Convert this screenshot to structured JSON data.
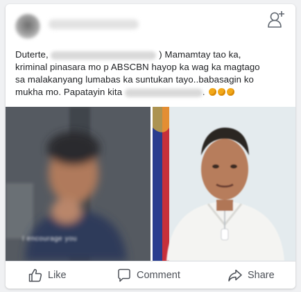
{
  "post": {
    "text_lines": [
      {
        "before": "Duterte,",
        "after": ") Mamamtay tao ka,"
      },
      {
        "text": "kriminal pinasara mo p ABSCBN hayop ka wag ka magtago"
      },
      {
        "text": "sa malakanyang lumabas ka suntukan tayo..babasagin ko"
      },
      {
        "before": "mukha mo. Papatayin kita",
        "after": "."
      }
    ]
  },
  "images": {
    "left_caption_blurred": "I encourage you"
  },
  "actions": {
    "like_label": "Like",
    "comment_label": "Comment",
    "share_label": "Share"
  },
  "icons": {
    "add_friend": "add-friend-icon",
    "like": "thumbs-up-icon",
    "comment": "comment-bubble-icon",
    "share": "share-arrow-icon"
  },
  "colors": {
    "action_text": "#4b4f56",
    "emoji": "#f2a818"
  }
}
